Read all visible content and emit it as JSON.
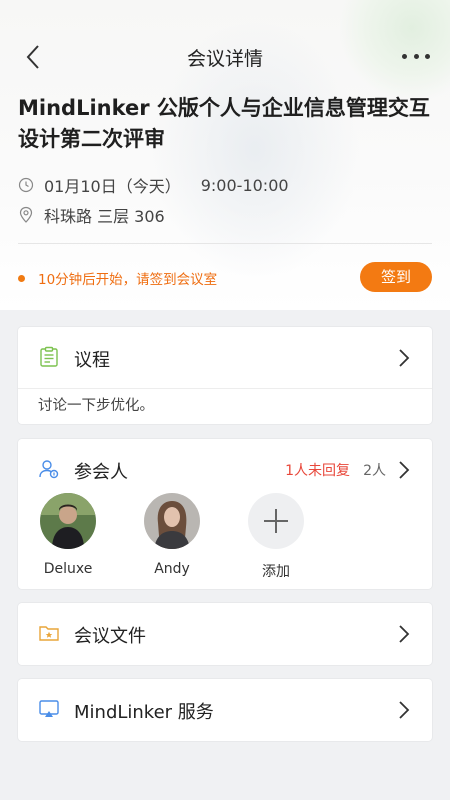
{
  "nav": {
    "title": "会议详情"
  },
  "meeting": {
    "title": "MindLinker 公版个人与企业信息管理交互设计第二次评审",
    "date": "01月10日（今天）",
    "time": "9:00-10:00",
    "location": "科珠路 三层 306",
    "notice": "10分钟后开始，请签到会议室",
    "checkin_label": "签到"
  },
  "agenda": {
    "label": "议程",
    "content": "讨论一下步优化。"
  },
  "participants": {
    "label": "参会人",
    "unreplied": "1人未回复",
    "count": "2人",
    "people": [
      {
        "name": "Deluxe"
      },
      {
        "name": "Andy"
      }
    ],
    "add_label": "添加"
  },
  "files": {
    "label": "会议文件"
  },
  "service": {
    "label": "MindLinker 服务"
  },
  "colors": {
    "accent": "#f37a12",
    "warning": "#e8473a"
  }
}
